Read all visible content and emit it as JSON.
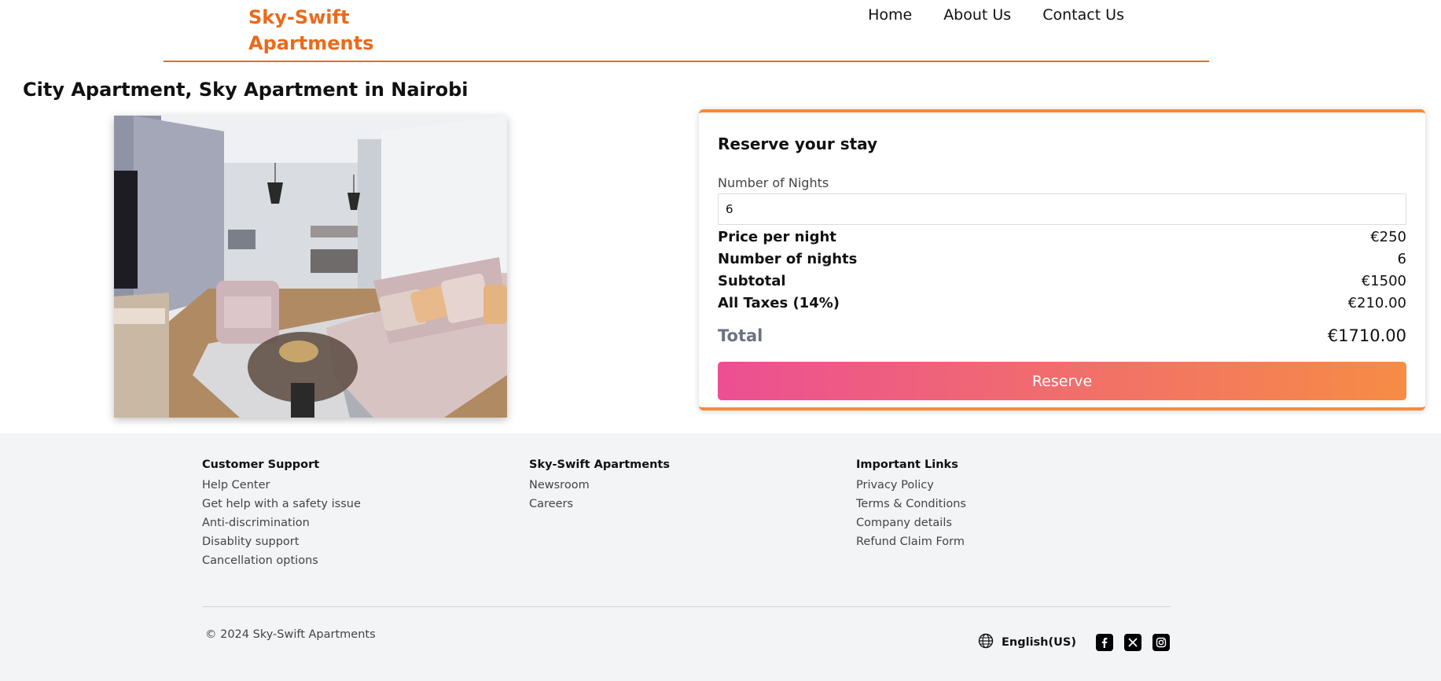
{
  "header": {
    "logo": "Sky-Swift Apartments",
    "nav": [
      "Home",
      "About Us",
      "Contact Us"
    ]
  },
  "page_title": "City Apartment, Sky Apartment in Nairobi",
  "reserve": {
    "title": "Reserve your stay",
    "nights_label": "Number of Nights",
    "nights_value": "6",
    "rows": [
      {
        "label": "Price per night",
        "value": "€250"
      },
      {
        "label": "Number of nights",
        "value": "6"
      },
      {
        "label": "Subtotal",
        "value": "€1500"
      },
      {
        "label": "All Taxes (14%)",
        "value": "€210.00"
      }
    ],
    "total_label": "Total",
    "total_value": "€1710.00",
    "button": "Reserve"
  },
  "footer": {
    "columns": [
      {
        "title": "Customer Support",
        "links": [
          "Help Center",
          "Get help with a safety issue",
          "Anti-discrimination",
          "Disablity support",
          "Cancellation options"
        ]
      },
      {
        "title": "Sky-Swift Apartments",
        "links": [
          "Newsroom",
          "Careers"
        ]
      },
      {
        "title": "Important Links",
        "links": [
          "Privacy Policy",
          "Terms & Conditions",
          "Company details",
          "Refund Claim Form"
        ]
      }
    ],
    "copyright": "© 2024 Sky-Swift Apartments",
    "language": "English(US)",
    "socials": [
      "facebook-icon",
      "x-icon",
      "instagram-icon"
    ]
  },
  "colors": {
    "brand": "#ea6a1b",
    "card_accent": "#f58b3a",
    "button_gradient_start": "#ec4f93",
    "button_gradient_end": "#f68c45"
  }
}
